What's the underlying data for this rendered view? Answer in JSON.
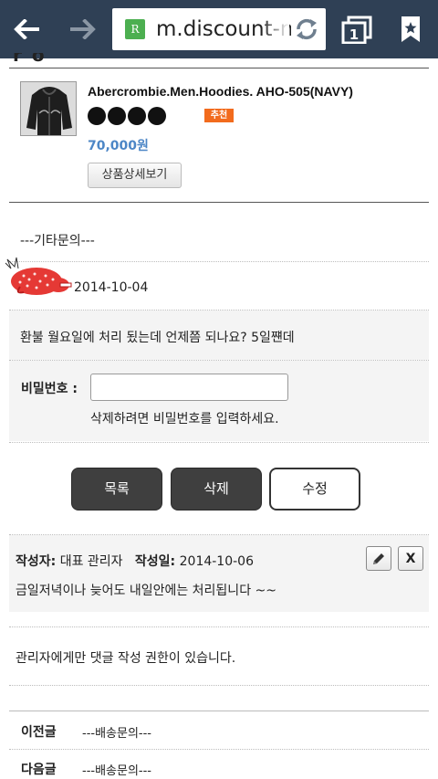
{
  "browser": {
    "url": "m.discount-n",
    "favicon_letter": "R",
    "tab_count": "1",
    "icons": [
      "back-arrow-icon",
      "forward-arrow-icon",
      "refresh-icon",
      "tabs-icon",
      "bookmark-icon"
    ]
  },
  "product": {
    "name": "Abercrombie.Men.Hoodies. AHO-505(NAVY)",
    "rating_dots": 4,
    "badge": "추천",
    "price": "70,000원",
    "detail_button": "상품상세보기"
  },
  "post": {
    "category": "---기타문의---",
    "date": "2014-10-04",
    "content": "환불 월요일에 처리 됬는데 언제쯤 되나요? 5일쨴데",
    "password_label": "비밀번호 :",
    "password_help": "삭제하려면 비밀번호를 입력하세요."
  },
  "actions": {
    "list": "목록",
    "delete": "삭제",
    "edit": "수정"
  },
  "reply": {
    "author_label": "작성자:",
    "author": "대표 관리자",
    "date_label": "작성일:",
    "date": "2014-10-06",
    "content": "금일저녁이나 늦어도 내일안에는 처리됩니다 ~~",
    "delete_icon_label": "X"
  },
  "notice": "관리자에게만 댓글 작성 권한이 있습니다.",
  "navigation": {
    "prev_label": "이전글",
    "prev_value": "---배송문의---",
    "next_label": "다음글",
    "next_value": "---배송문의---"
  },
  "colors": {
    "toolbar": "#2f4055",
    "price": "#4c86c6",
    "badge": "#f26b1d",
    "dark_button": "#3f3f3f"
  }
}
